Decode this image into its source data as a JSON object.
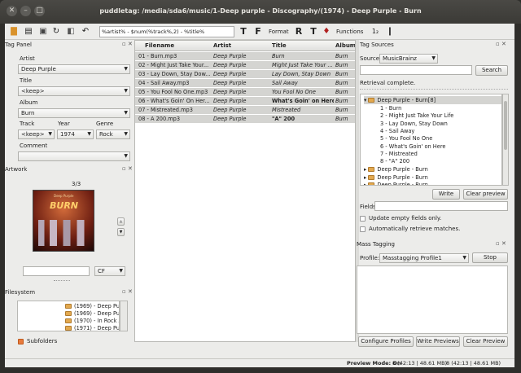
{
  "window": {
    "title": "puddletag: /media/sda6/music/1-Deep purple - Discography/(1974) - Deep Purple - Burn"
  },
  "toolbar": {
    "format_value": "%artist% - $num(%track%,2) - %title%",
    "format_label": "Format",
    "functions_label": "Functions"
  },
  "tag_panel": {
    "title": "Tag Panel",
    "artist_label": "Artist",
    "artist_value": "Deep Purple",
    "title_label": "Title",
    "title_value": "<keep>",
    "album_label": "Album",
    "album_value": "Burn",
    "track_label": "Track",
    "track_value": "<keep>",
    "year_label": "Year",
    "year_value": "1974",
    "genre_label": "Genre",
    "genre_value": "Rock",
    "comment_label": "Comment",
    "comment_value": ""
  },
  "artwork": {
    "title": "Artwork",
    "counter": "3/3",
    "cover_band": "Deep Purple",
    "cover_album": "BURN",
    "desc_value": "",
    "type_value": "CF"
  },
  "filesystem": {
    "title": "Filesystem",
    "items": [
      "(1969) - Deep Purpl",
      "(1969) - Deep Purpl",
      "(1970) - In Rock Ann",
      "(1971) - Deep Purpl"
    ],
    "subfolders_label": "Subfolders"
  },
  "table": {
    "columns": [
      "Filename",
      "Artist",
      "Title",
      "Album"
    ],
    "rows": [
      {
        "filename": "01 - Burn.mp3",
        "artist": "Deep Purple",
        "title": "Burn",
        "album": "Burn"
      },
      {
        "filename": "02 - Might Just Take Your...",
        "artist": "Deep Purple",
        "title": "Might Just Take Your ...",
        "album": "Burn"
      },
      {
        "filename": "03 - Lay Down, Stay Dow...",
        "artist": "Deep Purple",
        "title": "Lay Down, Stay Down",
        "album": "Burn"
      },
      {
        "filename": "04 - Sail Away.mp3",
        "artist": "Deep Purple",
        "title": "Sail Away",
        "album": "Burn"
      },
      {
        "filename": "05 - You Fool No One.mp3",
        "artist": "Deep Purple",
        "title": "You Fool No One",
        "album": "Burn"
      },
      {
        "filename": "06 - What's Goin' On Her...",
        "artist": "Deep Purple",
        "title": "What's Goin' on Here",
        "album": "Burn"
      },
      {
        "filename": "07 - Mistreated.mp3",
        "artist": "Deep Purple",
        "title": "Mistreated",
        "album": "Burn"
      },
      {
        "filename": "08 - A 200.mp3",
        "artist": "Deep Purple",
        "title": "\"A\" 200",
        "album": "Burn"
      }
    ]
  },
  "tag_sources": {
    "title": "Tag Sources",
    "source_label": "Source:",
    "source_value": "MusicBrainz",
    "search_value": "",
    "search_button": "Search",
    "status": "Retrieval complete.",
    "album_node": "Deep Purple - Burn[8]",
    "tracks": [
      "1 - Burn",
      "2 - Might Just Take Your Life",
      "3 - Lay Down, Stay Down",
      "4 - Sail Away",
      "5 - You Fool No One",
      "6 - What's Goin' on Here",
      "7 - Mistreated",
      "8 - \"A\" 200"
    ],
    "other_nodes": [
      "Deep Purple - Burn",
      "Deep Purple - Burn",
      "Deep Purple - Burn",
      "Deep Purple - Burn"
    ],
    "write_button": "Write",
    "clear_button": "Clear preview",
    "fields_label": "Fields",
    "fields_value": "",
    "update_empty_label": "Update empty fields only.",
    "auto_retrieve_label": "Automatically retrieve matches."
  },
  "mass_tagging": {
    "title": "Mass Tagging",
    "profile_label": "Profile:",
    "profile_value": "Masstagging Profile1",
    "stop_button": "Stop",
    "configure_button": "Configure Profiles",
    "write_previews_button": "Write Previews",
    "clear_preview_button": "Clear Preview"
  },
  "statusbar": {
    "preview_mode": "Preview Mode: On",
    "selection_info": "8 (42:13 | 48.61 MB)",
    "total_info": "8 (42:13 | 48.61 MB)"
  }
}
